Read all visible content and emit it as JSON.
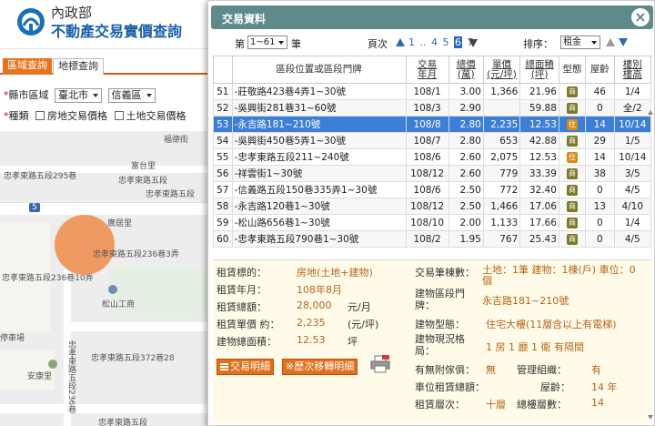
{
  "header": {
    "org": "內政部",
    "site": "不動產交易實價查詢",
    "logo_icon": "ministry-logo-icon"
  },
  "tabs": [
    {
      "label": "區域查詢",
      "active": true
    },
    {
      "label": "地標查詢",
      "active": false
    }
  ],
  "filter": {
    "region_label": "縣市區域",
    "city": "臺北市",
    "district": "信義區",
    "type_label": "種類",
    "opt1": "房地交易價格",
    "opt2": "土地交易價格"
  },
  "map": {
    "labels": [
      "福德街",
      "忠孝東路五段295巷",
      "忠孝東路五段",
      "富台里",
      "忠孝東路五段",
      "5",
      "廣居里",
      "忠孝東路五段236巷3弄",
      "忠孝東路五段236巷10弄",
      "松山工商",
      "忠孝東路五段372巷28",
      "安康里",
      "忠孝東路五段236巷",
      "停車場",
      "忠孝東路五段"
    ]
  },
  "dialog": {
    "title": "交易資料",
    "close": "×",
    "toolbar": {
      "prefix": "第",
      "range": "1~61",
      "suffix": "筆",
      "page_label": "頁次",
      "pages": [
        "1",
        "..",
        "4",
        "5",
        "6",
        "7"
      ],
      "current_page": "6",
      "sort_label": "排序：",
      "sort_value": "租金"
    },
    "columns": [
      "",
      "區段位置或區段門牌",
      "交易\n年月",
      "總價\n(萬)",
      "單價\n(元/坪)",
      "總面積\n(坪)",
      "型態",
      "屋齡",
      "樓別\n樓高"
    ],
    "rows": [
      {
        "no": "51",
        "addr": "-莊敬路423巷4弄1~30號",
        "ym": "108/1",
        "total": "3.00",
        "unit": "1,366",
        "area": "21.96",
        "type": "shop",
        "type_label": "商",
        "age": "46",
        "floor": "1/4"
      },
      {
        "no": "52",
        "addr": "-吳興街281巷31~60號",
        "ym": "108/3",
        "total": "2.90",
        "unit": "",
        "area": "59.88",
        "type": "shop",
        "type_label": "商",
        "age": "0",
        "floor": "全/2"
      },
      {
        "no": "53",
        "addr": "-永吉路181~210號",
        "ym": "108/8",
        "total": "2.80",
        "unit": "2,235",
        "area": "12.53",
        "type": "home",
        "type_label": "住",
        "age": "14",
        "floor": "10/14",
        "selected": true
      },
      {
        "no": "54",
        "addr": "-吳興街450巷5弄1~30號",
        "ym": "108/7",
        "total": "2.80",
        "unit": "653",
        "area": "42.88",
        "type": "shop",
        "type_label": "商",
        "age": "29",
        "floor": "1/5"
      },
      {
        "no": "55",
        "addr": "-忠孝東路五段211~240號",
        "ym": "108/6",
        "total": "2.60",
        "unit": "2,075",
        "area": "12.53",
        "type": "home",
        "type_label": "住",
        "age": "14",
        "floor": "10/14"
      },
      {
        "no": "56",
        "addr": "-祥雲街1~30號",
        "ym": "108/12",
        "total": "2.60",
        "unit": "779",
        "area": "33.39",
        "type": "shop",
        "type_label": "商",
        "age": "38",
        "floor": "3/5"
      },
      {
        "no": "57",
        "addr": "-信義路五段150巷335弄1~30號",
        "ym": "108/6",
        "total": "2.50",
        "unit": "772",
        "area": "32.40",
        "type": "shop",
        "type_label": "商",
        "age": "0",
        "floor": "4/5"
      },
      {
        "no": "58",
        "addr": "-永吉路120巷1~30號",
        "ym": "108/12",
        "total": "2.50",
        "unit": "1,466",
        "area": "17.06",
        "type": "shop",
        "type_label": "商",
        "age": "13",
        "floor": "4/10"
      },
      {
        "no": "59",
        "addr": "-松山路656巷1~30號",
        "ym": "108/10",
        "total": "2.00",
        "unit": "1,133",
        "area": "17.66",
        "type": "shop",
        "type_label": "商",
        "age": "0",
        "floor": "1/4"
      },
      {
        "no": "60",
        "addr": "-忠孝東路五段790巷1~30號",
        "ym": "108/2",
        "total": "1.95",
        "unit": "767",
        "area": "25.43",
        "type": "shop",
        "type_label": "商",
        "age": "0",
        "floor": "4/5"
      }
    ],
    "detail": {
      "target_label": "租賃標的：",
      "target_value": "房地(土地+建物)",
      "ym_label": "租賃年月：",
      "ym_value": "108年8月",
      "total_label": "租賃總額：",
      "total_value": "28,000",
      "total_unit": "元/月",
      "unit_label": "租賃單價 約：",
      "unit_value": "2,235",
      "unit_unit": "(元/坪)",
      "area_label": "建物總面積：",
      "area_value": "12.53",
      "area_unit": "坪",
      "count_label": "交易筆棟數：",
      "count_value": "土地：1筆 建物：1棟(戶) 車位：0個",
      "addr_label": "建物區段門牌：",
      "addr_value": "永吉路181~210號",
      "btype_label": "建物型態：",
      "btype_value": "住宅大樓(11層含以上有電梯)",
      "layout_label": "建物現況格局：",
      "layout_value": "1 房 1 廳 1 衛 有隔間",
      "furn_label": "有無附傢俱：",
      "furn_value": "無",
      "mgmt_label": "管理組織：",
      "mgmt_value": "有",
      "park_label": "車位租賃總額：",
      "age_label": "屋齡：",
      "age_value": "14 年",
      "floor_label": "租賃層次：",
      "floor_value": "十層",
      "height_label": "總樓層數：",
      "height_value": "14",
      "btn_detail": "交易明細",
      "btn_history": "※歷次移轉明細"
    }
  }
}
